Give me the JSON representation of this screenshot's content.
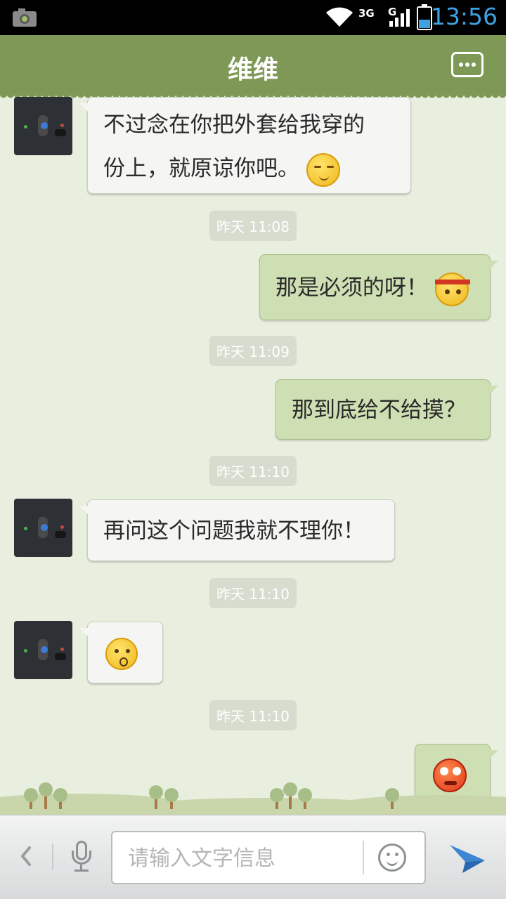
{
  "status_bar": {
    "time": "13:56",
    "network": "3G",
    "network2": "G"
  },
  "header": {
    "title": "维维"
  },
  "messages": [
    {
      "side": "in",
      "text_line1": "不过念在你把外套给我穿的",
      "text_line2": "份上，就原谅你吧。",
      "emoji": "smile-face-icon"
    },
    {
      "timestamp": "昨天 11:08"
    },
    {
      "side": "out",
      "text": "那是必须的呀！",
      "emoji": "headband-face-icon"
    },
    {
      "timestamp": "昨天 11:09"
    },
    {
      "side": "out",
      "text": "那到底给不给摸？"
    },
    {
      "timestamp": "昨天 11:10"
    },
    {
      "side": "in",
      "text": "再问这个问题我就不理你！"
    },
    {
      "timestamp": "昨天 11:10"
    },
    {
      "side": "in",
      "emoji": "wonder-face-icon"
    },
    {
      "timestamp": "昨天 11:10"
    },
    {
      "side": "out",
      "emoji": "angry-face-icon"
    }
  ],
  "input_bar": {
    "placeholder": "请输入文字信息"
  },
  "colors": {
    "header": "#7d9955",
    "background": "#e9efdf",
    "incoming_bubble": "#f5f6f3",
    "outgoing_bubble": "#cedfb3",
    "time_accent": "#3ea2e0"
  }
}
